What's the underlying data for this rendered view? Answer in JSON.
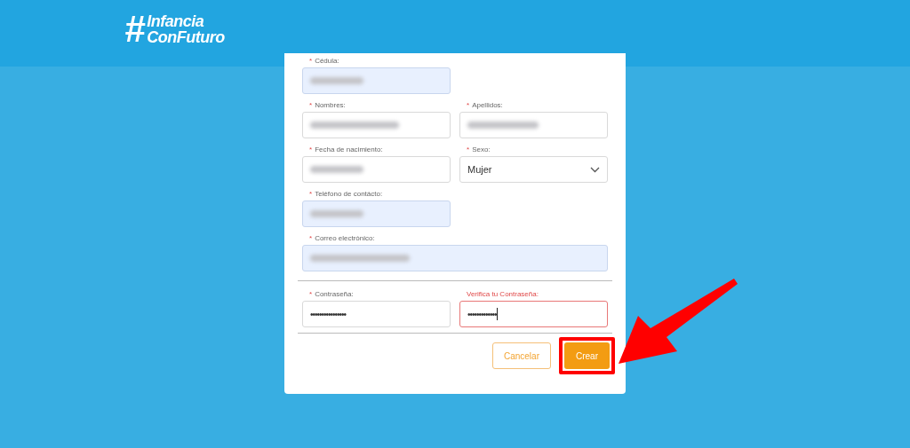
{
  "logo": {
    "mark": "#",
    "lines": [
      "Infancia",
      "ConFuturo"
    ]
  },
  "form": {
    "sections": [
      {
        "rows": [
          [
            {
              "label": "Cédula:",
              "required_mark": "*",
              "kind": "text",
              "redacted": true,
              "autofilled": true,
              "error": false
            }
          ],
          [
            {
              "label": "Nombres:",
              "required_mark": "*",
              "kind": "text",
              "redacted": true,
              "autofilled": false,
              "error": false
            },
            {
              "label": "Apellidos:",
              "required_mark": "*",
              "kind": "text",
              "redacted": true,
              "autofilled": false,
              "error": false
            }
          ],
          [
            {
              "label": "Fecha de nacimiento:",
              "required_mark": "*",
              "kind": "text",
              "redacted": true,
              "autofilled": false,
              "error": false
            },
            {
              "label": "Sexo:",
              "required_mark": "*",
              "kind": "select",
              "value": "Mujer",
              "autofilled": false,
              "error": false
            }
          ],
          [
            {
              "label": "Teléfono de contácto:",
              "required_mark": "*",
              "kind": "text",
              "redacted": true,
              "autofilled": true,
              "error": false
            }
          ],
          [
            {
              "label": "Correo electrónico:",
              "required_mark": "*",
              "kind": "wide",
              "redacted": true,
              "autofilled": true,
              "error": false
            }
          ]
        ]
      },
      {
        "rows": [
          [
            {
              "label": "Contraseña:",
              "required_mark": "*",
              "kind": "password",
              "value": "••••••••••••••••",
              "autofilled": false,
              "error": false,
              "focused": false
            },
            {
              "label": "Verifica tu Contraseña:",
              "kind": "password",
              "value": "•••••••••••••",
              "autofilled": false,
              "error": true,
              "focused": true
            }
          ]
        ]
      }
    ],
    "buttons": [
      {
        "label": "Cancelar",
        "kind": "outline"
      },
      {
        "label": "Crear",
        "kind": "primary",
        "highlighted": true
      }
    ]
  }
}
